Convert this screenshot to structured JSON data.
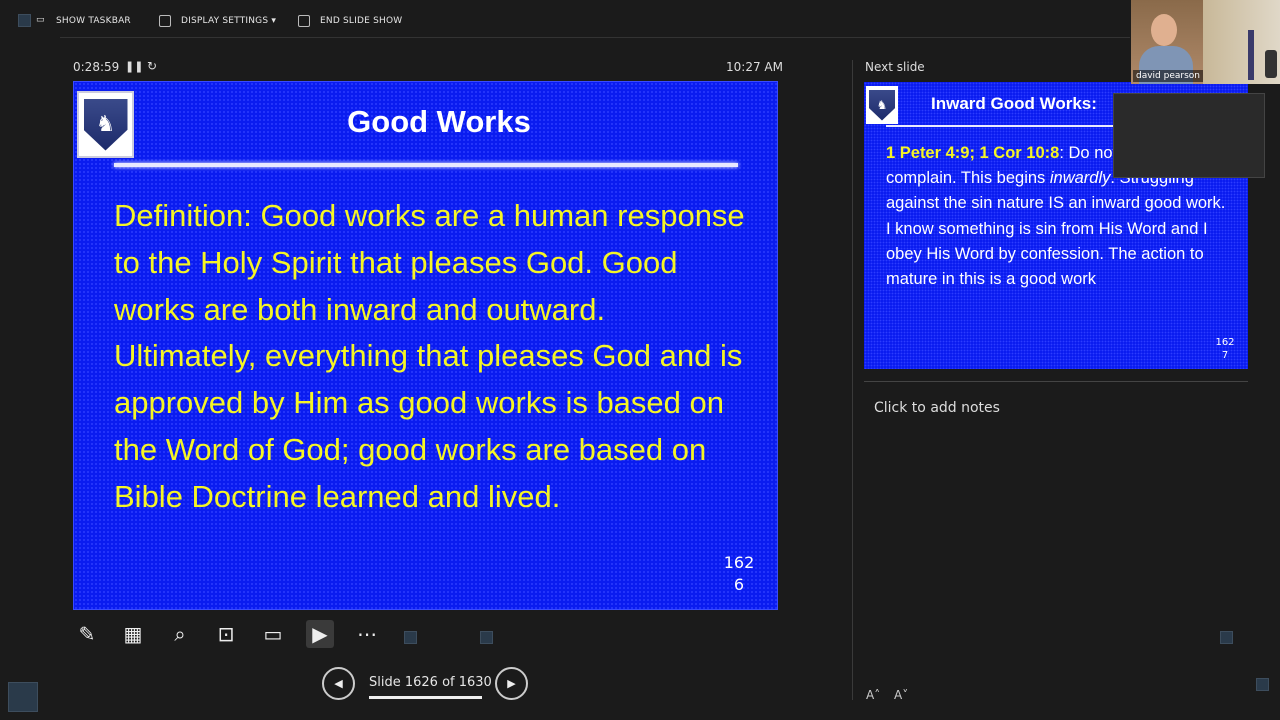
{
  "toolbar": {
    "show_taskbar": "SHOW TASKBAR",
    "display_settings": "DISPLAY SETTINGS ▾",
    "end_slide_show": "END SLIDE SHOW"
  },
  "presenter": {
    "elapsed": "0:28:59",
    "clock": "10:27 AM",
    "slide_counter": "Slide 1626 of 1630",
    "next_label": "Next slide",
    "notes_placeholder": "Click to add notes"
  },
  "current_slide": {
    "title": "Good Works",
    "body": "Definition: Good works are a human response to the Holy Spirit that pleases God. Good works are both inward and outward. Ultimately, everything that pleases God and is approved by Him as good works is based on the Word of God; good works are based on Bible Doctrine learned and lived.",
    "num_top": "162",
    "num_bottom": "6"
  },
  "next_slide": {
    "title": "Inward Good Works:",
    "ref": "1 Peter 4:9; 1 Cor 10:8",
    "text_before_italic": ": Do not grumble or complain. This begins ",
    "italic": "inwardly",
    "text_after_italic": ". Struggling against the sin nature IS an inward good work. I know something is sin from His Word and I obey His Word by confession. The action to mature in this is a good work",
    "num_top": "162",
    "num_bottom": "7"
  },
  "video": {
    "participant": "david pearson"
  },
  "icons": {
    "pen": "pen-icon",
    "all_slides": "grid-icon",
    "zoom": "magnifier-icon",
    "pointer": "laser-icon",
    "subtitles": "subtitles-icon",
    "camera": "camera-icon",
    "more": "more-icon"
  }
}
